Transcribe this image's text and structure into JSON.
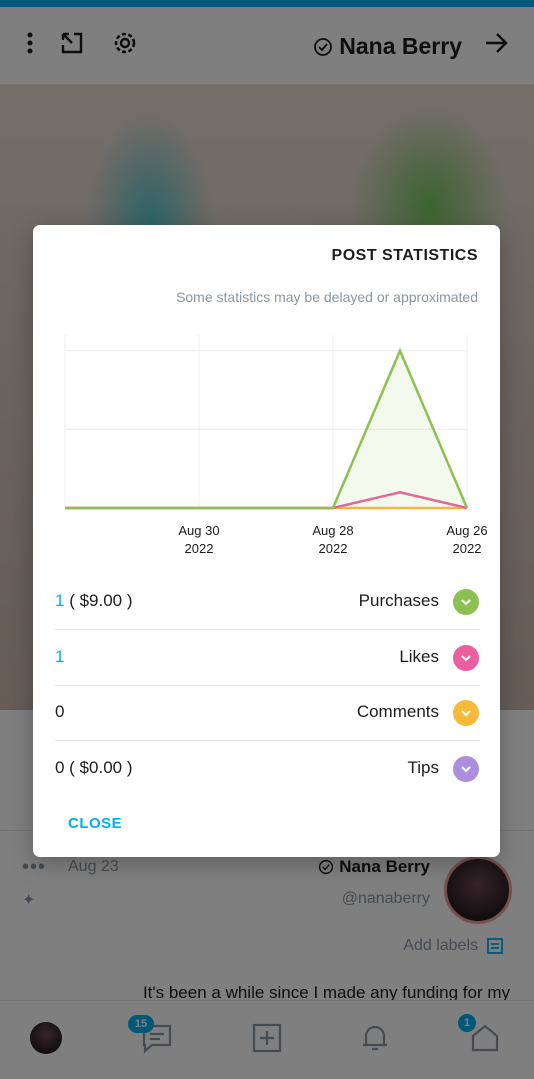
{
  "header": {
    "title": "Nana Berry"
  },
  "post": {
    "author": "Nana Berry",
    "handle": "@nanaberry",
    "date": "Aug 23",
    "add_labels": "Add labels",
    "text": "It's been a while since I made any funding for my"
  },
  "nav": {
    "home_badge": "1",
    "messages_badge": "15"
  },
  "modal": {
    "title": "POST STATISTICS",
    "subtitle": "Some statistics may be delayed or approximated",
    "close_label": "CLOSE",
    "stats": [
      {
        "label": "Purchases",
        "value_accent": "1",
        "value_rest": " ( $9.00 )",
        "color": "#8cc152",
        "icon": "chevron-down-icon"
      },
      {
        "label": "Likes",
        "value_accent": "1",
        "value_rest": "",
        "color": "#ec5f9e",
        "icon": "chevron-down-icon"
      },
      {
        "label": "Comments",
        "value_accent": "",
        "value_rest": "0",
        "color": "#f6b93b",
        "icon": "chevron-down-icon"
      },
      {
        "label": "Tips",
        "value_accent": "",
        "value_rest": "0 ( $0.00 )",
        "color": "#ac8fdc",
        "icon": "chevron-down-icon"
      }
    ]
  },
  "chart_data": {
    "type": "line",
    "categories": [
      "Aug 26 2022",
      "Aug 28 2022",
      "Aug 30 2022"
    ],
    "tick_labels": [
      {
        "line1": "Aug 26",
        "line2": "2022"
      },
      {
        "line1": "Aug 28",
        "line2": "2022"
      },
      {
        "line1": "Aug 30",
        "line2": "2022"
      }
    ],
    "x": [
      0,
      1,
      2,
      3,
      4,
      5,
      6
    ],
    "series": [
      {
        "name": "Purchases",
        "color": "#8cc152",
        "values": [
          0,
          1,
          0,
          0,
          0,
          0,
          0
        ]
      },
      {
        "name": "Likes",
        "color": "#ec5f9e",
        "values": [
          0,
          0.1,
          0,
          0,
          0,
          0,
          0
        ]
      },
      {
        "name": "Comments",
        "color": "#f6b93b",
        "values": [
          0,
          0,
          0,
          0,
          0,
          0,
          0
        ]
      }
    ],
    "ylim": [
      0,
      1.1
    ],
    "grid": true
  }
}
